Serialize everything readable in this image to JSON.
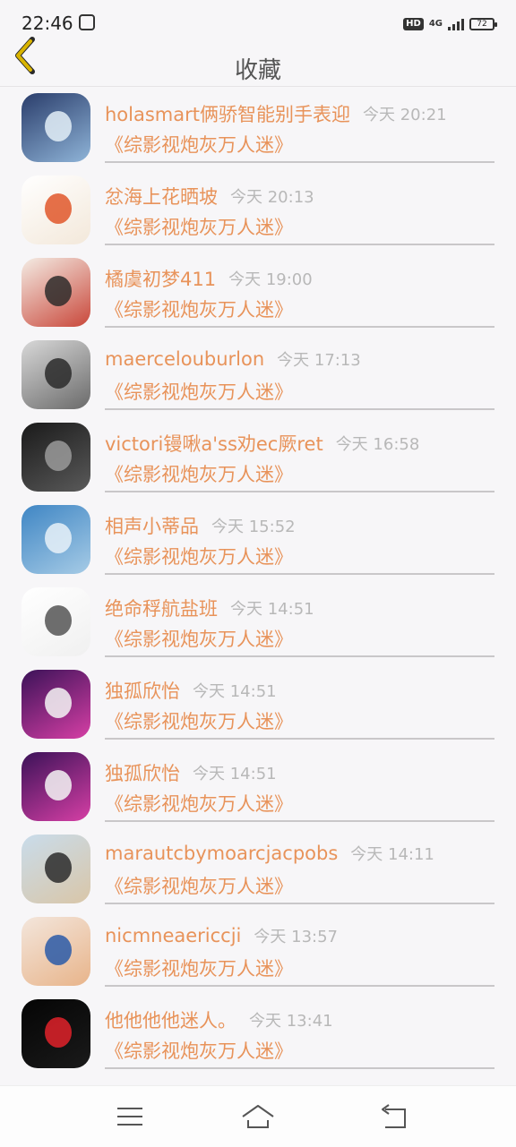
{
  "status": {
    "time": "22:46",
    "hd": "HD",
    "network": "4G",
    "battery": "72"
  },
  "header": {
    "title": "收藏"
  },
  "items": [
    {
      "name": "holasmart俩骄智能别手表迎",
      "time": "今天 20:21",
      "title": "《综影视炮灰万人迷》",
      "avatar": {
        "bg1": "#2a3d6b",
        "bg2": "#8fb4d8",
        "accent": "#e3eef7"
      }
    },
    {
      "name": "忿海上花晒坡",
      "time": "今天 20:13",
      "title": "《综影视炮灰万人迷》",
      "avatar": {
        "bg1": "#ffffff",
        "bg2": "#f3e8da",
        "accent": "#e0572a"
      }
    },
    {
      "name": "橘虞初梦411",
      "time": "今天 19:00",
      "title": "《综影视炮灰万人迷》",
      "avatar": {
        "bg1": "#f4ece4",
        "bg2": "#c9473a",
        "accent": "#2e2c2a"
      }
    },
    {
      "name": "maercelouburlon",
      "time": "今天 17:13",
      "title": "《综影视炮灰万人迷》",
      "avatar": {
        "bg1": "#d8d8d8",
        "bg2": "#6a6a6a",
        "accent": "#2a2a2a"
      }
    },
    {
      "name": "victori镘啾a'ss劝ec厥ret",
      "time": "今天 16:58",
      "title": "《综影视炮灰万人迷》",
      "avatar": {
        "bg1": "#1a1a1a",
        "bg2": "#5a5a5a",
        "accent": "#9a9a9a"
      }
    },
    {
      "name": "相声小蒂品",
      "time": "今天 15:52",
      "title": "《综影视炮灰万人迷》",
      "avatar": {
        "bg1": "#3f86c4",
        "bg2": "#a6cbe6",
        "accent": "#e8f1f8"
      }
    },
    {
      "name": "绝命稃航盐班",
      "time": "今天 14:51",
      "title": "《综影视炮灰万人迷》",
      "avatar": {
        "bg1": "#ffffff",
        "bg2": "#f0f0f0",
        "accent": "#555555"
      }
    },
    {
      "name": "独孤欣怡",
      "time": "今天 14:51",
      "title": "《综影视炮灰万人迷》",
      "avatar": {
        "bg1": "#3b1258",
        "bg2": "#d63fa5",
        "accent": "#f4f4f4"
      }
    },
    {
      "name": "独孤欣怡",
      "time": "今天 14:51",
      "title": "《综影视炮灰万人迷》",
      "avatar": {
        "bg1": "#3b1258",
        "bg2": "#d63fa5",
        "accent": "#f4f4f4"
      }
    },
    {
      "name": "marautcbymoarcjacpobs",
      "time": "今天 14:11",
      "title": "《综影视炮灰万人迷》",
      "avatar": {
        "bg1": "#c9dceb",
        "bg2": "#d9c6a8",
        "accent": "#2c2c2c"
      }
    },
    {
      "name": "nicmneaericcji",
      "time": "今天 13:57",
      "title": "《综影视炮灰万人迷》",
      "avatar": {
        "bg1": "#f3e6dc",
        "bg2": "#e8b48a",
        "accent": "#2a5aa8"
      }
    },
    {
      "name": "他他他他迷人。",
      "time": "今天 13:41",
      "title": "《综影视炮灰万人迷》",
      "avatar": {
        "bg1": "#050505",
        "bg2": "#1a1a1a",
        "accent": "#e0222a"
      }
    }
  ],
  "colors": {
    "accent": "#e8935a",
    "back": "#d9b400",
    "muted": "#b8b8b8"
  }
}
